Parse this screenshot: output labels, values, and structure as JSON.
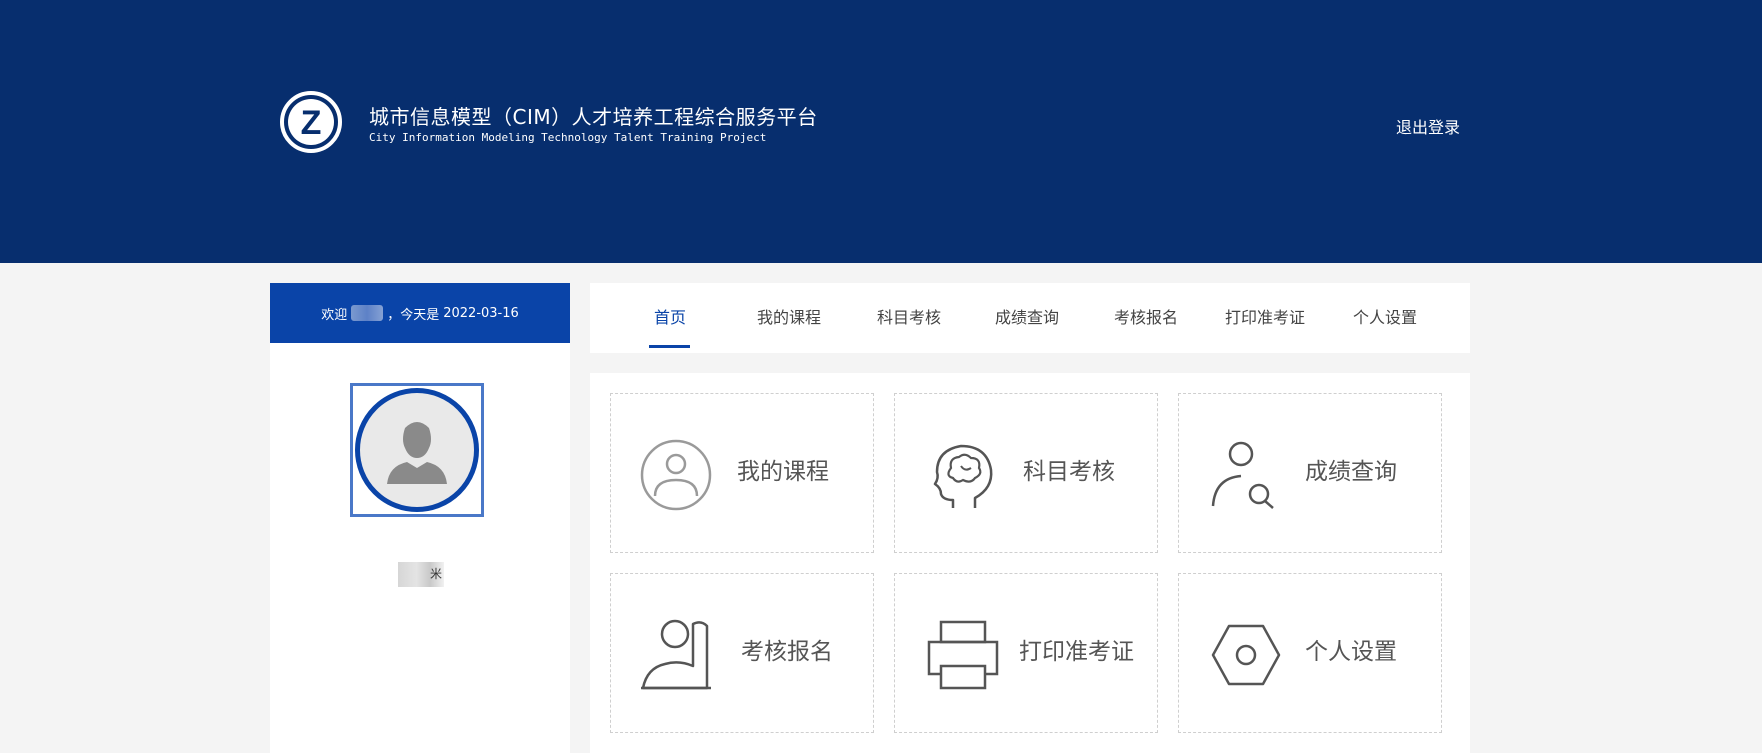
{
  "header": {
    "title_cn": "城市信息模型（CIM）人才培养工程综合服务平台",
    "title_en": "City Information Modeling Technology Talent Training Project",
    "logo_letter": "Z",
    "logout_label": "退出登录"
  },
  "sidebar": {
    "welcome_prefix": "欢迎",
    "welcome_middle": "，今天是",
    "date": "2022-03-16",
    "username_fragment": "米"
  },
  "nav": {
    "tabs": [
      {
        "label": "首页",
        "active": true
      },
      {
        "label": "我的课程"
      },
      {
        "label": "科目考核"
      },
      {
        "label": "成绩查询"
      },
      {
        "label": "考核报名"
      },
      {
        "label": "打印准考证"
      },
      {
        "label": "个人设置"
      }
    ]
  },
  "cards": [
    {
      "label": "我的课程",
      "icon": "user-circle-icon"
    },
    {
      "label": "科目考核",
      "icon": "brain-head-icon"
    },
    {
      "label": "成绩查询",
      "icon": "user-search-icon"
    },
    {
      "label": "考核报名",
      "icon": "raise-hand-icon"
    },
    {
      "label": "打印准考证",
      "icon": "printer-icon"
    },
    {
      "label": "个人设置",
      "icon": "hex-nut-icon"
    }
  ],
  "colors": {
    "header_bg": "#072e6e",
    "accent": "#0a44a8",
    "page_bg": "#f4f4f4"
  }
}
